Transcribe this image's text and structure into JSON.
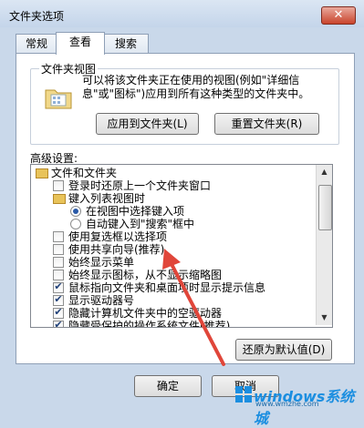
{
  "window": {
    "title": "文件夹选项",
    "close_glyph": "✕"
  },
  "tabs": [
    {
      "label": "常规"
    },
    {
      "label": "查看"
    },
    {
      "label": "搜索"
    }
  ],
  "folder_views": {
    "group_label": "文件夹视图",
    "description": "可以将该文件夹正在使用的视图(例如\"详细信息\"或\"图标\")应用到所有这种类型的文件夹中。",
    "apply_button": "应用到文件夹(L)",
    "reset_button": "重置文件夹(R)"
  },
  "advanced": {
    "label": "高级设置:",
    "items": [
      {
        "type": "folder",
        "label": "文件和文件夹"
      },
      {
        "type": "checkbox",
        "label": "登录时还原上一个文件夹窗口",
        "checked": false
      },
      {
        "type": "folder",
        "label": "键入列表视图时"
      },
      {
        "type": "radio",
        "label": "在视图中选择键入项",
        "selected": true
      },
      {
        "type": "radio",
        "label": "自动键入到\"搜索\"框中",
        "selected": false
      },
      {
        "type": "checkbox",
        "label": "使用复选框以选择项",
        "checked": false
      },
      {
        "type": "checkbox",
        "label": "使用共享向导(推荐)",
        "checked": false
      },
      {
        "type": "checkbox",
        "label": "始终显示菜单",
        "checked": false
      },
      {
        "type": "checkbox",
        "label": "始终显示图标，从不显示缩略图",
        "checked": false
      },
      {
        "type": "checkbox",
        "label": "鼠标指向文件夹和桌面项时显示提示信息",
        "checked": true
      },
      {
        "type": "checkbox",
        "label": "显示驱动器号",
        "checked": true
      },
      {
        "type": "checkbox",
        "label": "隐藏计算机文件夹中的空驱动器",
        "checked": true
      },
      {
        "type": "checkbox",
        "label": "隐藏受保护的操作系统文件(推荐)",
        "checked": true
      }
    ],
    "restore_button": "还原为默认值(D)"
  },
  "footer": {
    "ok_button": "确定",
    "cancel_button": "取消"
  },
  "watermark": {
    "text": "windows系统城",
    "sub": "www.wmzhe.com"
  },
  "colors": {
    "accent": "#2a5aa8",
    "annotation_arrow": "#e0463a",
    "watermark": "#1b8ee0"
  },
  "icons": {
    "close": "close-icon",
    "folder": "folder-icon",
    "up": "up-arrow-icon",
    "down": "down-arrow-icon"
  }
}
